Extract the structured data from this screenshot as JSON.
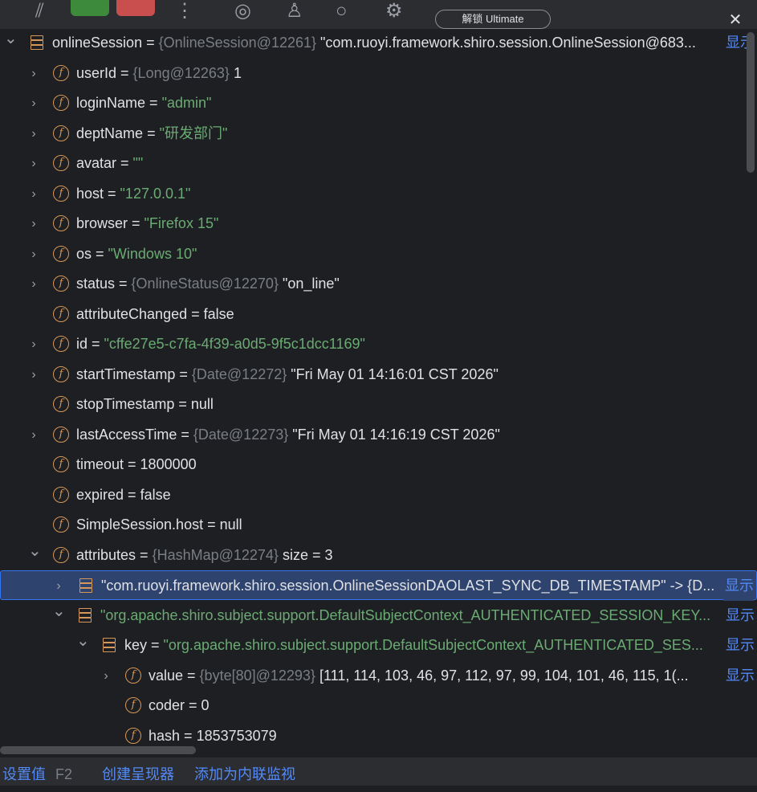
{
  "toolbar": {
    "ultimate_pill": "解锁 Ultimate",
    "icons": [
      "run-icon",
      "stop-icon",
      "more-icon",
      "antenna-icon",
      "profile-icon",
      "search-icon",
      "settings-icon",
      "close-icon"
    ],
    "close_label": "✕"
  },
  "tree": {
    "show_link": "显示",
    "rows": [
      {
        "name": "onlineSession",
        "ref": "{OnlineSession@12261}",
        "value": "\"com.ruoyi.framework.shiro.session.OnlineSession@683...",
        "value_kind": "plain",
        "icon": "object-stack-icon",
        "expand": "expanded",
        "has_show": true
      },
      {
        "name": "userId",
        "ref": "{Long@12263}",
        "value": "1",
        "value_kind": "plain",
        "icon": "field-icon",
        "expand": "collapsed"
      },
      {
        "name": "loginName",
        "ref": "",
        "value": "\"admin\"",
        "value_kind": "str",
        "icon": "field-icon",
        "expand": "collapsed"
      },
      {
        "name": "deptName",
        "ref": "",
        "value": "\"研发部门\"",
        "value_kind": "str",
        "icon": "field-icon",
        "expand": "collapsed"
      },
      {
        "name": "avatar",
        "ref": "",
        "value": "\"\"",
        "value_kind": "str",
        "icon": "field-icon",
        "expand": "collapsed"
      },
      {
        "name": "host",
        "ref": "",
        "value": "\"127.0.0.1\"",
        "value_kind": "str",
        "icon": "field-icon",
        "expand": "collapsed"
      },
      {
        "name": "browser",
        "ref": "",
        "value": "\"Firefox 15\"",
        "value_kind": "str",
        "icon": "field-icon",
        "expand": "collapsed"
      },
      {
        "name": "os",
        "ref": "",
        "value": "\"Windows 10\"",
        "value_kind": "str",
        "icon": "field-icon",
        "expand": "collapsed"
      },
      {
        "name": "status",
        "ref": "{OnlineStatus@12270}",
        "value": "\"on_line\"",
        "value_kind": "plain",
        "icon": "field-icon",
        "expand": "collapsed"
      },
      {
        "name": "attributeChanged",
        "ref": "",
        "value": "false",
        "value_kind": "plain",
        "icon": "field-icon",
        "expand": "none"
      },
      {
        "name": "id",
        "ref": "",
        "value": "\"cffe27e5-c7fa-4f39-a0d5-9f5c1dcc1169\"",
        "value_kind": "str",
        "icon": "field-icon",
        "expand": "collapsed"
      },
      {
        "name": "startTimestamp",
        "ref": "{Date@12272}",
        "value": "\"Fri May 01 14:16:01 CST 2026\"",
        "value_kind": "plain",
        "icon": "field-icon",
        "expand": "collapsed"
      },
      {
        "name": "stopTimestamp",
        "ref": "",
        "value": "null",
        "value_kind": "plain",
        "icon": "field-icon",
        "expand": "none"
      },
      {
        "name": "lastAccessTime",
        "ref": "{Date@12273}",
        "value": "\"Fri May 01 14:16:19 CST 2026\"",
        "value_kind": "plain",
        "icon": "field-icon",
        "expand": "collapsed"
      },
      {
        "name": "timeout",
        "ref": "",
        "value": "1800000",
        "value_kind": "plain",
        "icon": "field-icon",
        "expand": "none"
      },
      {
        "name": "expired",
        "ref": "",
        "value": "false",
        "value_kind": "plain",
        "icon": "field-icon",
        "expand": "none"
      },
      {
        "name": "SimpleSession.host",
        "ref": "",
        "value": "null",
        "value_kind": "plain",
        "icon": "field-icon",
        "expand": "none"
      },
      {
        "name": "attributes",
        "ref": "{HashMap@12274}",
        "value": " size = 3",
        "value_kind": "plain",
        "icon": "field-icon",
        "expand": "expanded"
      },
      {
        "name": "\"com.ruoyi.framework.shiro.session.OnlineSessionDAOLAST_SYNC_DB_TIMESTAMP\" -> {D...",
        "ref": "",
        "value": "",
        "value_kind": "plain",
        "icon": "object-stack-icon",
        "expand": "collapsed",
        "has_show": true,
        "selected": true,
        "bare": true
      },
      {
        "name": "\"org.apache.shiro.subject.support.DefaultSubjectContext_AUTHENTICATED_SESSION_KEY...",
        "ref": "",
        "value": "",
        "value_kind": "str",
        "icon": "object-stack-icon",
        "expand": "expanded",
        "has_show": true,
        "bare": true
      },
      {
        "name": "key",
        "ref": "",
        "value": "\"org.apache.shiro.subject.support.DefaultSubjectContext_AUTHENTICATED_SES...",
        "value_kind": "str",
        "icon": "object-stack-icon",
        "expand": "expanded",
        "has_show": true
      },
      {
        "name": "value",
        "ref": "{byte[80]@12293}",
        "value": "[111, 114, 103, 46, 97, 112, 97, 99, 104, 101, 46, 115, 1(...",
        "value_kind": "plain",
        "icon": "field-final-icon",
        "expand": "collapsed",
        "has_show": true
      },
      {
        "name": "coder",
        "ref": "",
        "value": "0",
        "value_kind": "plain",
        "icon": "field-final-icon",
        "expand": "none"
      },
      {
        "name": "hash",
        "ref": "",
        "value": "1853753079",
        "value_kind": "plain",
        "icon": "field-icon",
        "expand": "none"
      }
    ]
  },
  "status_bar": {
    "set_value": "设置值",
    "set_value_key": "F2",
    "create_renderer": "创建呈现器",
    "add_inline_watch": "添加为内联监视"
  }
}
